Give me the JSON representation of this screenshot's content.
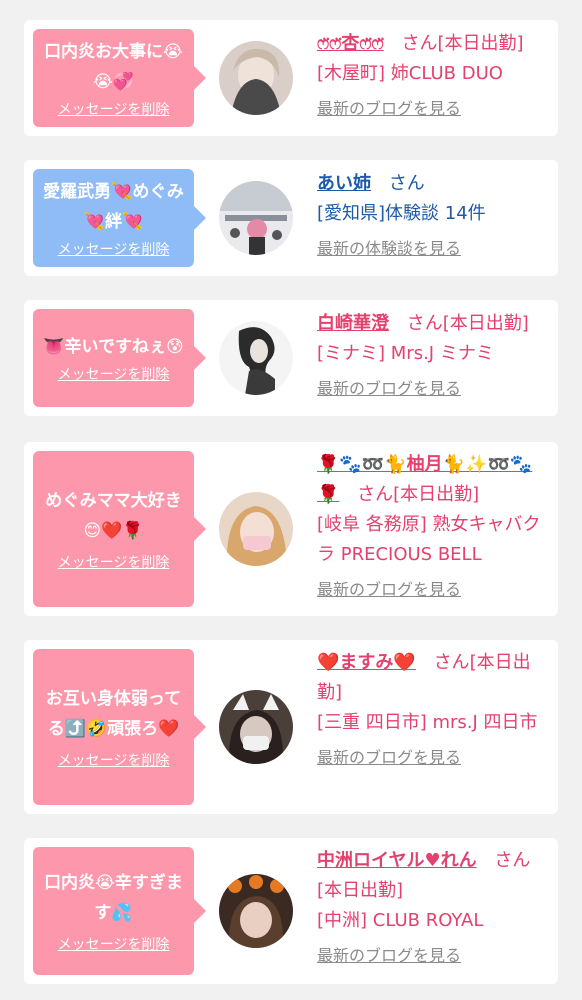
{
  "colors": {
    "background": "#f1f1f1",
    "card": "#ffffff",
    "bubble_pink": "#fd97ab",
    "bubble_blue": "#8fbbf6",
    "name_pink": "#e4416f",
    "name_blue": "#1f5aa6",
    "link_gray": "#8a8a8a"
  },
  "items": [
    {
      "message": "口内炎お大事に😭😭💞",
      "delete_label": "メッセージを削除",
      "name": "ෆ̈ෆ̈杏ෆ̈ෆ̈",
      "honorific": "さん",
      "status": "[本日出勤]",
      "shop": "[木屋町] 姉CLUB DUO",
      "link": "最新のブログを見る",
      "avatar_icon": "user-photo-icon"
    },
    {
      "message": "愛羅武勇💘めぐみ💘絆💘",
      "delete_label": "メッセージを削除",
      "name": "あい姉",
      "honorific": "さん",
      "status": "",
      "shop": "[愛知県]体験談 14件",
      "link": "最新の体験談を見る",
      "avatar_icon": "user-photo-icon"
    },
    {
      "message": "👅辛いですねぇ😰",
      "delete_label": "メッセージを削除",
      "name": "白崎華澄",
      "honorific": "さん",
      "status": "[本日出勤]",
      "shop": "[ミナミ] Mrs.J ミナミ",
      "link": "最新のブログを見る",
      "avatar_icon": "user-photo-icon"
    },
    {
      "message": "めぐみママ大好き😊❤️🌹",
      "delete_label": "メッセージを削除",
      "name": "🌹🐾➿🐈柚月🐈✨➿🐾🌹",
      "honorific": "さん",
      "status": "[本日出勤]",
      "shop": "[岐阜 各務原] 熟女キャバクラ PRECIOUS BELL",
      "link": "最新のブログを見る",
      "avatar_icon": "user-photo-icon"
    },
    {
      "message": "お互い身体弱ってる⤴️🤣頑張ろ❤️",
      "delete_label": "メッセージを削除",
      "name": "❤️ますみ❤️",
      "honorific": "さん",
      "status": "[本日出勤]",
      "shop": "[三重 四日市] mrs.J 四日市",
      "link": "最新のブログを見る",
      "avatar_icon": "user-photo-icon"
    },
    {
      "message": "口内炎😭辛すぎます💦",
      "delete_label": "メッセージを削除",
      "name": "中洲ロイヤル♥れん",
      "honorific": "さん",
      "status": "[本日出勤]",
      "shop": "[中洲] CLUB ROYAL",
      "link": "最新のブログを見る",
      "avatar_icon": "user-photo-icon"
    }
  ]
}
